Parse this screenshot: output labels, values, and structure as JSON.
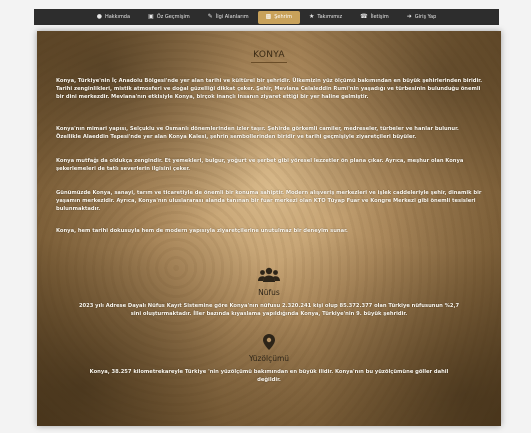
{
  "nav": {
    "items": [
      {
        "label": "Hakkımda",
        "icon": "user-icon"
      },
      {
        "label": "Öz Geçmişim",
        "icon": "id-card-icon"
      },
      {
        "label": "İlgi Alanlarım",
        "icon": "pen-icon"
      },
      {
        "label": "Şehrim",
        "icon": "city-icon",
        "active": true
      },
      {
        "label": "Takımımız",
        "icon": "trophy-icon"
      },
      {
        "label": "İletişim",
        "icon": "phone-icon"
      },
      {
        "label": "Giriş Yap",
        "icon": "login-icon"
      }
    ]
  },
  "page": {
    "title": "KONYA",
    "paragraphs": [
      "Konya, Türkiye'nin İç Anadolu Bölgesi'nde yer alan tarihi ve kültürel bir şehridir. Ülkemizin yüz ölçümü bakımından en büyük şehirlerinden biridir. Tarihi zenginlikleri, mistik atmosferi ve doğal güzelliği dikkat çeker. Şehir, Mevlana Celaleddin Rumi'nin yaşadığı ve türbesinin bulunduğu önemli bir dini merkezdir. Mevlana'nın etkisiyle Konya, birçok inançlı insanın ziyaret ettiği bir yer haline gelmiştir.",
      "Konya'nın mimari yapısı, Selçuklu ve Osmanlı dönemlerinden izler taşır. Şehirde görkemli camiler, medreseler, türbeler ve hanlar bulunur. Özellikle Alaeddin Tepesi'nde yer alan Konya Kalesi, şehrin sembollerinden biridir ve tarihi geçmişiyle ziyaretçileri büyüler.",
      "Konya mutfağı da oldukça zengindir. Et yemekleri, bulgur, yoğurt ve şerbet gibi yöresel lezzetler ön plana çıkar. Ayrıca, meşhur olan Konya şekerlemeleri de tatlı severlerin ilgisini çeker.",
      "Günümüzde Konya, sanayi, tarım ve ticaretiyle de önemli bir konuma sahiptir. Modern alışveriş merkezleri ve işlek caddeleriyle şehir, dinamik bir yaşamın merkezidir. Ayrıca, Konya'nın uluslararası alanda tanınan bir fuar merkezi olan KTO Tüyap Fuar ve Kongre Merkezi gibi önemli tesisleri bulunmaktadır.",
      "Konya, hem tarihi dokusuyla hem de modern yapısıyla ziyaretçilerine unutulmaz bir deneyim sunar."
    ]
  },
  "population": {
    "icon": "users-icon",
    "title": "Nüfus",
    "text": "2023 yılı Adrese Dayalı Nüfus Kayıt Sistemine göre Konya'nın nüfusu 2.320.241 kişi olup 85.372.377 olan Türkiye nüfusunun %2,7 sini oluşturmaktadır. İller bazında kıyaslama yapıldığında Konya, Türkiye'nin 9. büyük şehridir."
  },
  "area": {
    "icon": "map-pin-icon",
    "title": "Yüzölçümü",
    "text": "Konya, 38.257 kilometrekareyle Türkiye 'nin yüzölçümü bakımından en büyük ilidir. Konya'nın bu yüzölçümüne göller dahil değildir."
  }
}
